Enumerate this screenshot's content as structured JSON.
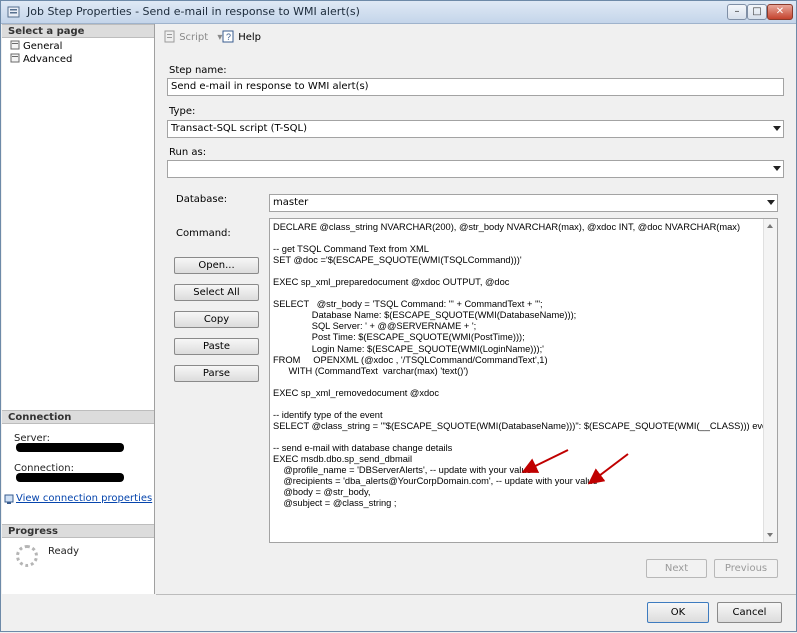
{
  "window": {
    "title": "Job Step Properties - Send e-mail in response to WMI alert(s)"
  },
  "left": {
    "select_page_header": "Select a page",
    "nav": [
      {
        "label": "General"
      },
      {
        "label": "Advanced"
      }
    ],
    "connection_header": "Connection",
    "server_label": "Server:",
    "connection_label": "Connection:",
    "view_connection_link": "View connection properties",
    "progress_header": "Progress",
    "progress_status": "Ready"
  },
  "toolbar": {
    "script_label": "Script",
    "help_label": "Help"
  },
  "form": {
    "step_name_label": "Step name:",
    "step_name_value": "Send e-mail in response to WMI alert(s)",
    "type_label": "Type:",
    "type_value": "Transact-SQL script (T-SQL)",
    "run_as_label": "Run as:",
    "run_as_value": "",
    "database_label": "Database:",
    "database_value": "master",
    "command_label": "Command:",
    "command_text": "DECLARE @class_string NVARCHAR(200), @str_body NVARCHAR(max), @xdoc INT, @doc NVARCHAR(max)\n\n-- get TSQL Command Text from XML\nSET @doc ='$(ESCAPE_SQUOTE(WMI(TSQLCommand)))'\n\nEXEC sp_xml_preparedocument @xdoc OUTPUT, @doc\n\nSELECT   @str_body = 'TSQL Command: \"' + CommandText + '\";\n               Database Name: $(ESCAPE_SQUOTE(WMI(DatabaseName)));\n               SQL Server: ' + @@SERVERNAME + ';\n               Post Time: $(ESCAPE_SQUOTE(WMI(PostTime)));\n               Login Name: $(ESCAPE_SQUOTE(WMI(LoginName)));'\nFROM     OPENXML (@xdoc , '/TSQLCommand/CommandText',1)\n      WITH (CommandText  varchar(max) 'text()')\n\nEXEC sp_xml_removedocument @xdoc\n\n-- identify type of the event\nSELECT @class_string = '\"$(ESCAPE_SQUOTE(WMI(DatabaseName)))\": $(ESCAPE_SQUOTE(WMI(__CLASS))) event'\n\n-- send e-mail with database change details\nEXEC msdb.dbo.sp_send_dbmail\n    @profile_name = 'DBServerAlerts', -- update with your value\n    @recipients = 'dba_alerts@YourCorpDomain.com', -- update with your value\n    @body = @str_body,\n    @subject = @class_string ;"
  },
  "buttons": {
    "open": "Open...",
    "select_all": "Select All",
    "copy": "Copy",
    "paste": "Paste",
    "parse": "Parse",
    "next": "Next",
    "previous": "Previous",
    "ok": "OK",
    "cancel": "Cancel"
  },
  "colors": {
    "annotation_arrow": "#c00000",
    "link": "#0645ad"
  }
}
